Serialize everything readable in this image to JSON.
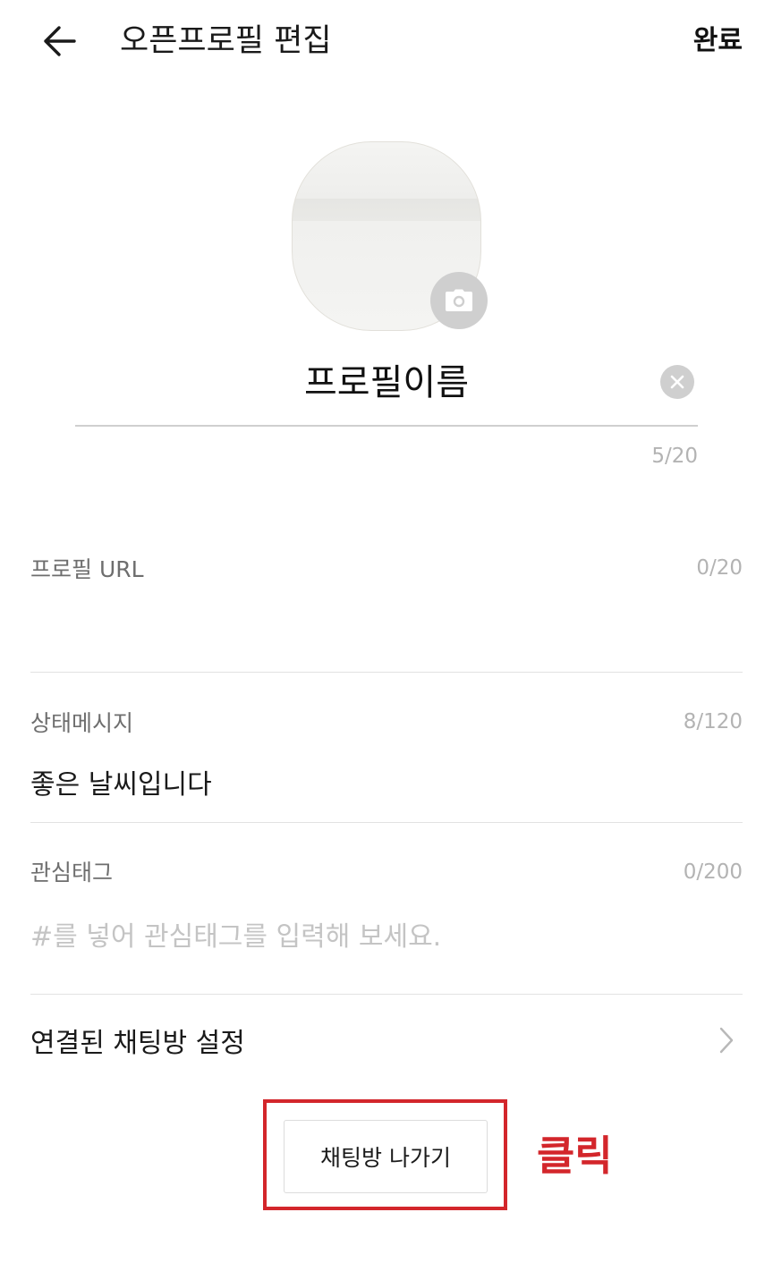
{
  "header": {
    "title": "오픈프로필 편집",
    "done_label": "완료"
  },
  "profile": {
    "name": "프로필이름",
    "name_counter": "5/20"
  },
  "fields": {
    "url": {
      "label": "프로필 URL",
      "counter": "0/20",
      "value": ""
    },
    "status": {
      "label": "상태메시지",
      "counter": "8/120",
      "value": "좋은 날씨입니다"
    },
    "tags": {
      "label": "관심태그",
      "counter": "0/200",
      "placeholder": "#를 넣어 관심태그를 입력해 보세요."
    }
  },
  "linked_chat": {
    "label": "연결된 채팅방 설정"
  },
  "leave_button": {
    "label": "채팅방 나가기"
  },
  "annotation": {
    "text": "클릭",
    "color": "#d3262b"
  },
  "icons": {
    "back": "arrow-left-icon",
    "camera": "camera-icon",
    "clear": "close-icon",
    "chevron": "chevron-right-icon"
  }
}
